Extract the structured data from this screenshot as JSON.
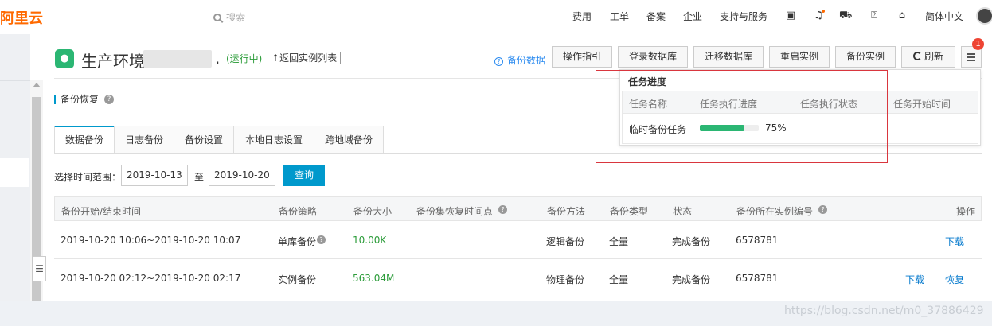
{
  "brand": "阿里云",
  "search": {
    "placeholder": "搜索"
  },
  "topnav": {
    "items": [
      "费用",
      "工单",
      "备案",
      "企业",
      "支持与服务"
    ],
    "language": "简体中文"
  },
  "header": {
    "title": "生产环境",
    "title_suffix": ".",
    "status": "(运行中)",
    "back_label": "返回实例列表",
    "backup_data_link": "备份数据",
    "buttons": [
      "操作指引",
      "登录数据库",
      "迁移数据库",
      "重启实例",
      "备份实例",
      "刷新"
    ],
    "notification_count": "1"
  },
  "section": {
    "title": "备份恢复"
  },
  "tabs": [
    "数据备份",
    "日志备份",
    "备份设置",
    "本地日志设置",
    "跨地域备份"
  ],
  "filter": {
    "label": "选择时间范围：",
    "start": "2019-10-13",
    "to": "至",
    "end": "2019-10-20",
    "query": "查询"
  },
  "table": {
    "headers": [
      "备份开始/结束时间",
      "备份策略",
      "备份大小",
      "备份集恢复时间点",
      "备份方法",
      "备份类型",
      "状态",
      "备份所在实例编号",
      "操作"
    ],
    "rows": [
      {
        "time": "2019-10-20 10:06~2019-10-20 10:07",
        "strategy": "单库备份",
        "size": "10.00K",
        "restore_point": "",
        "method": "逻辑备份",
        "type": "全量",
        "status": "完成备份",
        "instance": "6578781",
        "actions": [
          "下载"
        ]
      },
      {
        "time": "2019-10-20 02:12~2019-10-20 02:17",
        "strategy": "实例备份",
        "size": "563.04M",
        "restore_point": "",
        "method": "物理备份",
        "type": "全量",
        "status": "完成备份",
        "instance": "6578781",
        "actions": [
          "下载",
          "恢复"
        ]
      }
    ]
  },
  "task_popup": {
    "title": "任务进度",
    "headers": [
      "任务名称",
      "任务执行进度",
      "任务执行状态",
      "任务开始时间"
    ],
    "task": {
      "name": "临时备份任务",
      "progress": 0.75,
      "progress_label": "75%"
    }
  },
  "watermark": "https://blog.csdn.net/m0_37886429",
  "colors": {
    "accent": "#0099cc",
    "brand": "#ff6a00",
    "success": "#2bb673",
    "highlight": "#d9363e"
  }
}
